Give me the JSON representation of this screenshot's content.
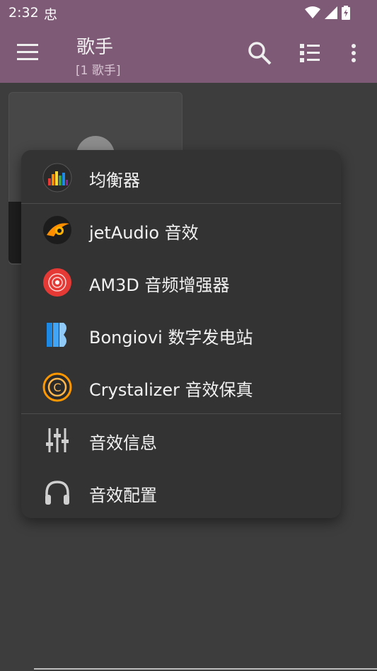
{
  "status": {
    "time": "2:32",
    "notif_glyph": "忠"
  },
  "appbar": {
    "title": "歌手",
    "subtitle": "[1 歌手]"
  },
  "menu": {
    "items": [
      {
        "label": "均衡器",
        "icon": "equalizer-app-icon"
      },
      {
        "label": "jetAudio 音效",
        "icon": "jetaudio-app-icon"
      },
      {
        "label": "AM3D 音频增强器",
        "icon": "am3d-app-icon"
      },
      {
        "label": "Bongiovi 数字发电站",
        "icon": "bongiovi-app-icon"
      },
      {
        "label": "Crystalizer 音效保真",
        "icon": "crystalizer-app-icon"
      },
      {
        "label": "音效信息",
        "icon": "sliders-icon"
      },
      {
        "label": "音效配置",
        "icon": "headphones-icon"
      }
    ]
  },
  "colors": {
    "appbar": "#7e5a76",
    "background": "#3d3d3d",
    "popup": "#333333"
  }
}
